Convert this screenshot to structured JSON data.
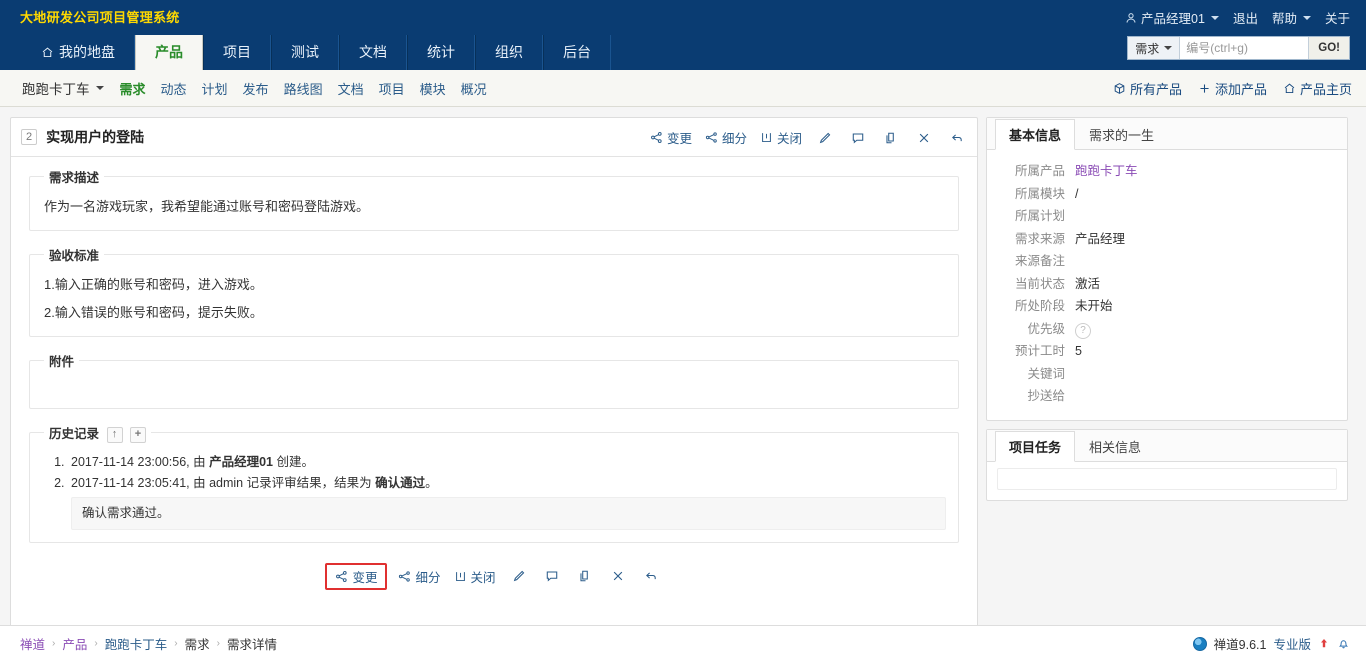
{
  "header": {
    "brand": "大地研发公司项目管理系统",
    "user": {
      "name": "产品经理01",
      "icon": "user-icon"
    },
    "logout": "退出",
    "help": "帮助",
    "about": "关于",
    "tabs": [
      {
        "label": "我的地盘",
        "icon": "home-icon",
        "active": false
      },
      {
        "label": "产品",
        "active": true
      },
      {
        "label": "项目",
        "active": false
      },
      {
        "label": "测试",
        "active": false
      },
      {
        "label": "文档",
        "active": false
      },
      {
        "label": "统计",
        "active": false
      },
      {
        "label": "组织",
        "active": false
      },
      {
        "label": "后台",
        "active": false
      }
    ],
    "search": {
      "type": "需求",
      "placeholder": "编号(ctrl+g)",
      "value": "",
      "go_label": "GO!"
    }
  },
  "modulebar": {
    "product": "跑跑卡丁车",
    "links": [
      {
        "label": "需求",
        "active": true
      },
      {
        "label": "动态",
        "active": false
      },
      {
        "label": "计划",
        "active": false
      },
      {
        "label": "发布",
        "active": false
      },
      {
        "label": "路线图",
        "active": false
      },
      {
        "label": "文档",
        "active": false
      },
      {
        "label": "项目",
        "active": false
      },
      {
        "label": "模块",
        "active": false
      },
      {
        "label": "概况",
        "active": false
      }
    ],
    "actions": [
      {
        "label": "所有产品",
        "icon": "cube-icon"
      },
      {
        "label": "添加产品",
        "icon": "plus-icon"
      },
      {
        "label": "产品主页",
        "icon": "home-icon"
      }
    ]
  },
  "story": {
    "id": "2",
    "title": "实现用户的登陆",
    "blocks": {
      "desc_legend": "需求描述",
      "desc_text": "作为一名游戏玩家，我希望能通过账号和密码登陆游戏。",
      "criteria_legend": "验收标准",
      "criteria_lines": [
        "1.输入正确的账号和密码，进入游戏。",
        "2.输入错误的账号和密码，提示失败。"
      ],
      "files_legend": "附件",
      "history_legend": "历史记录",
      "history_collapse_icon": "arrow-up-icon",
      "history_expand_icon": "plus-icon"
    },
    "history": [
      {
        "text": "2017-11-14 23:00:56, 由 ",
        "actor": "产品经理01",
        "tail": " 创建。"
      },
      {
        "text": "2017-11-14 23:05:41, 由 ",
        "actor": "admin",
        "tail": " 记录评审结果，结果为 ",
        "result": "确认通过",
        "tail2": "。"
      }
    ],
    "history_comment": "确认需求通过。",
    "actions": [
      {
        "label": "变更",
        "icon": "share-icon",
        "highlighted_top": false
      },
      {
        "label": "细分",
        "icon": "branch-icon"
      },
      {
        "label": "关闭",
        "icon": "close-box-icon"
      },
      {
        "label": "",
        "icon": "pencil-icon"
      },
      {
        "label": "",
        "icon": "comment-icon"
      },
      {
        "label": "",
        "icon": "copy-icon"
      },
      {
        "label": "",
        "icon": "x-icon"
      },
      {
        "label": "",
        "icon": "back-arrow-icon"
      }
    ],
    "highlighted_action": "变更"
  },
  "sidebar": {
    "info_panel": {
      "tabs": [
        {
          "label": "基本信息",
          "active": true
        },
        {
          "label": "需求的一生",
          "active": false
        }
      ],
      "rows": [
        {
          "label": "所属产品",
          "value": "跑跑卡丁车",
          "link": true
        },
        {
          "label": "所属模块",
          "value": "/",
          "link": false
        },
        {
          "label": "所属计划",
          "value": "",
          "link": false
        },
        {
          "label": "需求来源",
          "value": "产品经理",
          "link": false
        },
        {
          "label": "来源备注",
          "value": "",
          "link": false
        },
        {
          "label": "当前状态",
          "value": "激活",
          "link": false
        },
        {
          "label": "所处阶段",
          "value": "未开始",
          "link": false
        },
        {
          "label": "优先级",
          "value": "?",
          "badge": true
        },
        {
          "label": "预计工时",
          "value": "5",
          "link": false
        },
        {
          "label": "关键词",
          "value": "",
          "link": false
        },
        {
          "label": "抄送给",
          "value": "",
          "link": false
        }
      ]
    },
    "task_panel": {
      "tabs": [
        {
          "label": "项目任务",
          "active": true
        },
        {
          "label": "相关信息",
          "active": false
        }
      ]
    }
  },
  "footer": {
    "breadcrumb": [
      {
        "label": "禅道",
        "style": "purple"
      },
      {
        "label": "产品",
        "style": "purple"
      },
      {
        "label": "跑跑卡丁车",
        "style": "blue"
      },
      {
        "label": "需求",
        "style": "plain"
      },
      {
        "label": "需求详情",
        "style": "plain"
      }
    ],
    "separator": "›",
    "version": "禅道9.6.1",
    "edition": "专业版",
    "upgrade_icon": "arrow-up-icon",
    "bell_icon": "bell-icon"
  },
  "colors": {
    "nav_bg": "#0a3c72",
    "brand_text": "#ffd900",
    "active_tab_text": "#2a8c2a",
    "link": "#2b5c8a",
    "visited_link": "#8a4bb5",
    "highlight_box": "#e03030"
  }
}
